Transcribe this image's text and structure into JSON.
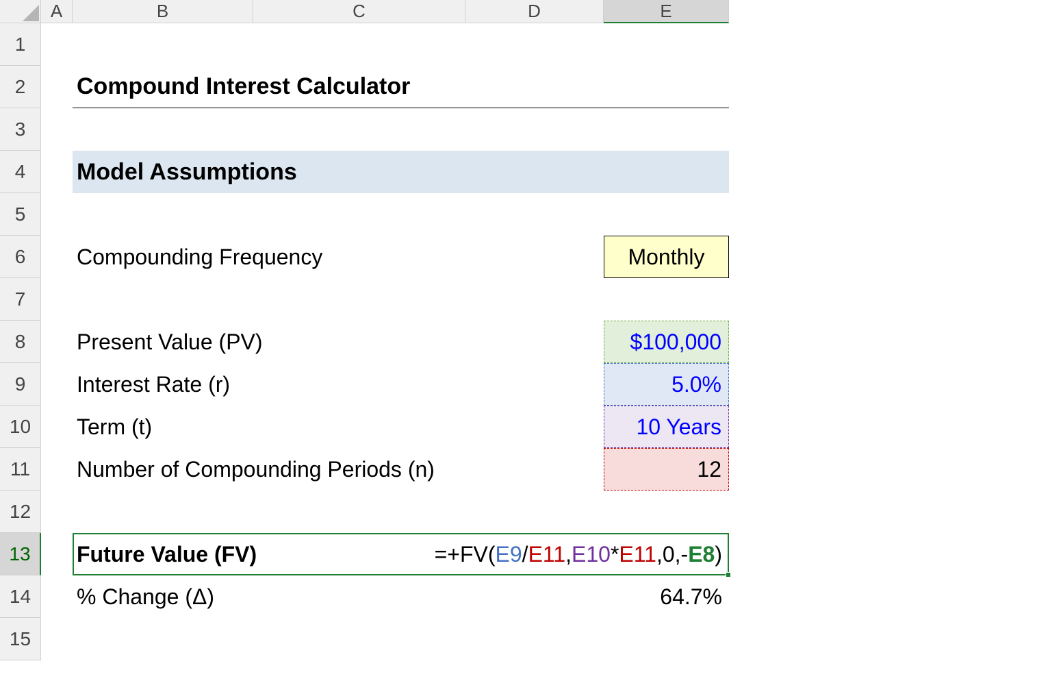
{
  "columns": [
    "A",
    "B",
    "C",
    "D",
    "E"
  ],
  "rows": [
    "1",
    "2",
    "3",
    "4",
    "5",
    "6",
    "7",
    "8",
    "9",
    "10",
    "11",
    "12",
    "13",
    "14",
    "15"
  ],
  "active_column": "E",
  "active_row": "13",
  "title": "Compound Interest Calculator",
  "section_header": "Model Assumptions",
  "labels": {
    "compounding_frequency": "Compounding Frequency",
    "present_value": "Present Value (PV)",
    "interest_rate": "Interest Rate (r)",
    "term": "Term (t)",
    "num_periods": "Number of Compounding Periods (n)",
    "future_value": "Future Value (FV)",
    "pct_change": "% Change (Δ)"
  },
  "values": {
    "compounding_frequency": "Monthly",
    "present_value": "$100,000",
    "interest_rate": "5.0%",
    "term": "10 Years",
    "num_periods": "12",
    "pct_change": "64.7%"
  },
  "formula": {
    "prefix": "=+FV(",
    "t1": "E9",
    "sep1": "/",
    "t2": "E11",
    "sep2": ",",
    "t3": "E10",
    "sep3": "*",
    "t4": "E11",
    "sep4": ",0,-",
    "t5": "E8",
    "suffix": ")"
  }
}
